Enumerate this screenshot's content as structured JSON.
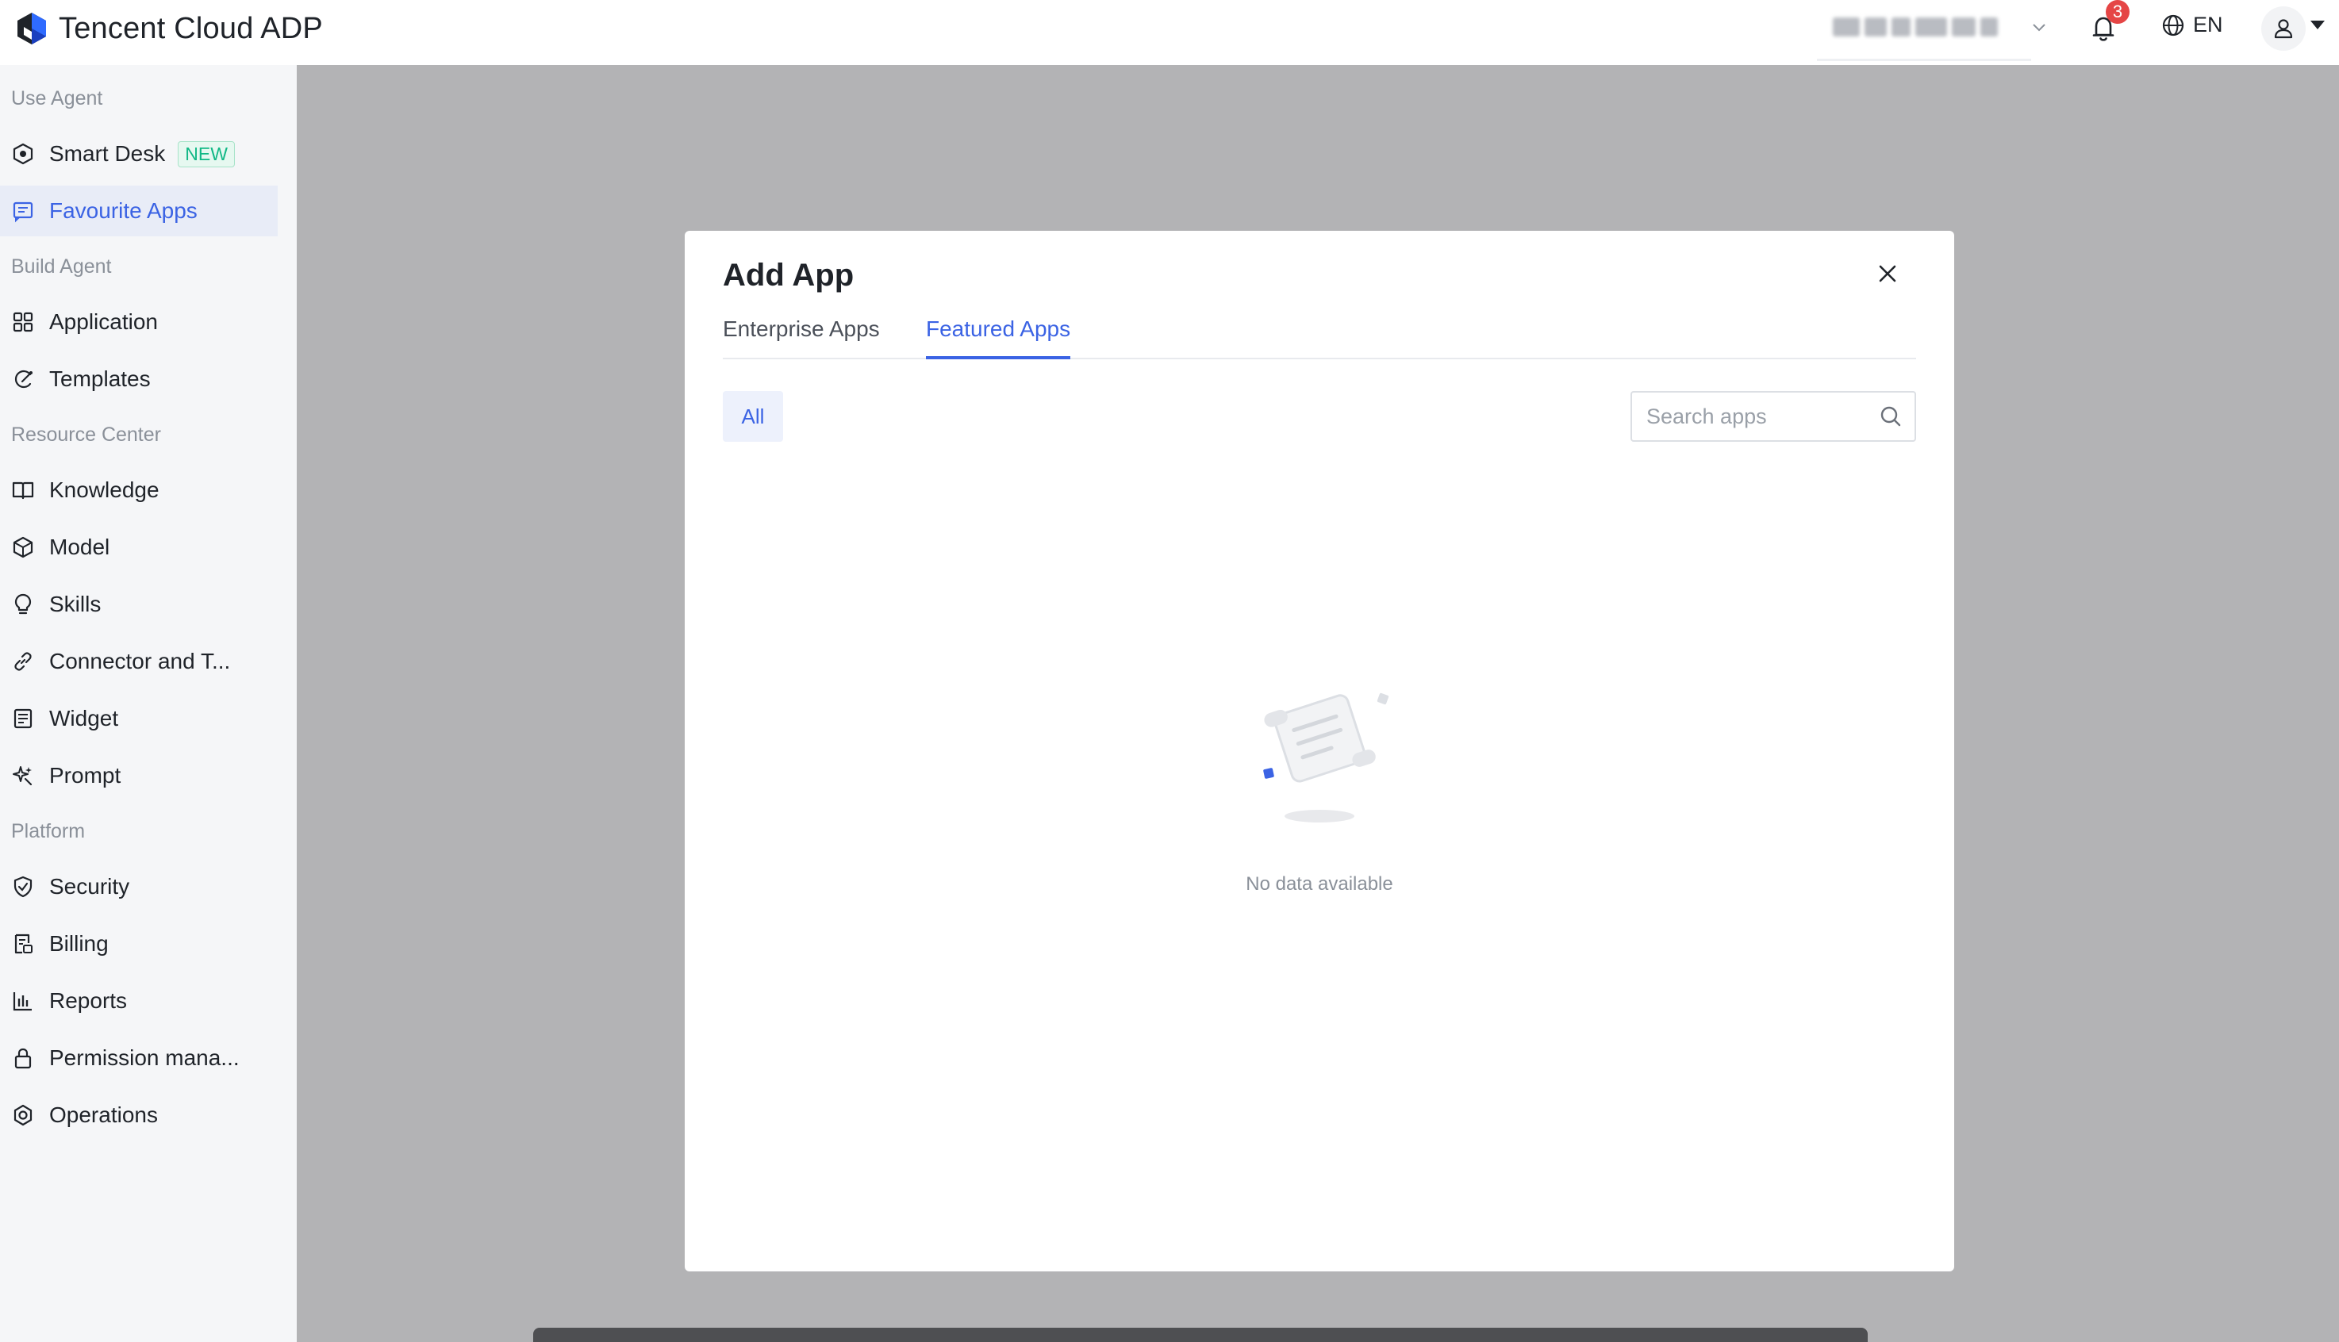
{
  "app": {
    "title": "Tencent Cloud ADP"
  },
  "header": {
    "notification_count": "3",
    "language": "EN"
  },
  "sidebar": {
    "groups": [
      {
        "title": "Use Agent"
      },
      {
        "title": "Build Agent"
      },
      {
        "title": "Resource Center"
      },
      {
        "title": "Platform"
      }
    ],
    "items": [
      {
        "label": "Smart Desk",
        "badge": "NEW",
        "icon": "smart-desk-icon"
      },
      {
        "label": "Favourite Apps",
        "icon": "favourite-apps-icon",
        "active": true
      },
      {
        "label": "Application",
        "icon": "grid-icon"
      },
      {
        "label": "Templates",
        "icon": "templates-icon"
      },
      {
        "label": "Knowledge",
        "icon": "book-icon"
      },
      {
        "label": "Model",
        "icon": "cube-icon"
      },
      {
        "label": "Skills",
        "icon": "lightbulb-icon"
      },
      {
        "label": "Connector and T...",
        "icon": "link-icon"
      },
      {
        "label": "Widget",
        "icon": "widget-icon"
      },
      {
        "label": "Prompt",
        "icon": "sparkle-icon"
      },
      {
        "label": "Security",
        "icon": "shield-icon"
      },
      {
        "label": "Billing",
        "icon": "billing-icon"
      },
      {
        "label": "Reports",
        "icon": "bar-chart-icon"
      },
      {
        "label": "Permission mana...",
        "icon": "lock-icon"
      },
      {
        "label": "Operations",
        "icon": "gear-icon"
      }
    ]
  },
  "modal": {
    "title": "Add App",
    "tabs": [
      {
        "label": "Enterprise Apps",
        "active": false
      },
      {
        "label": "Featured Apps",
        "active": true
      }
    ],
    "filter_chip": "All",
    "search": {
      "placeholder": "Search apps",
      "value": ""
    },
    "empty_text": "No data available"
  },
  "colors": {
    "accent": "#3b63e4",
    "badge_red": "#e54545",
    "new_green": "#12b886",
    "overlay": "#b3b3b5"
  }
}
